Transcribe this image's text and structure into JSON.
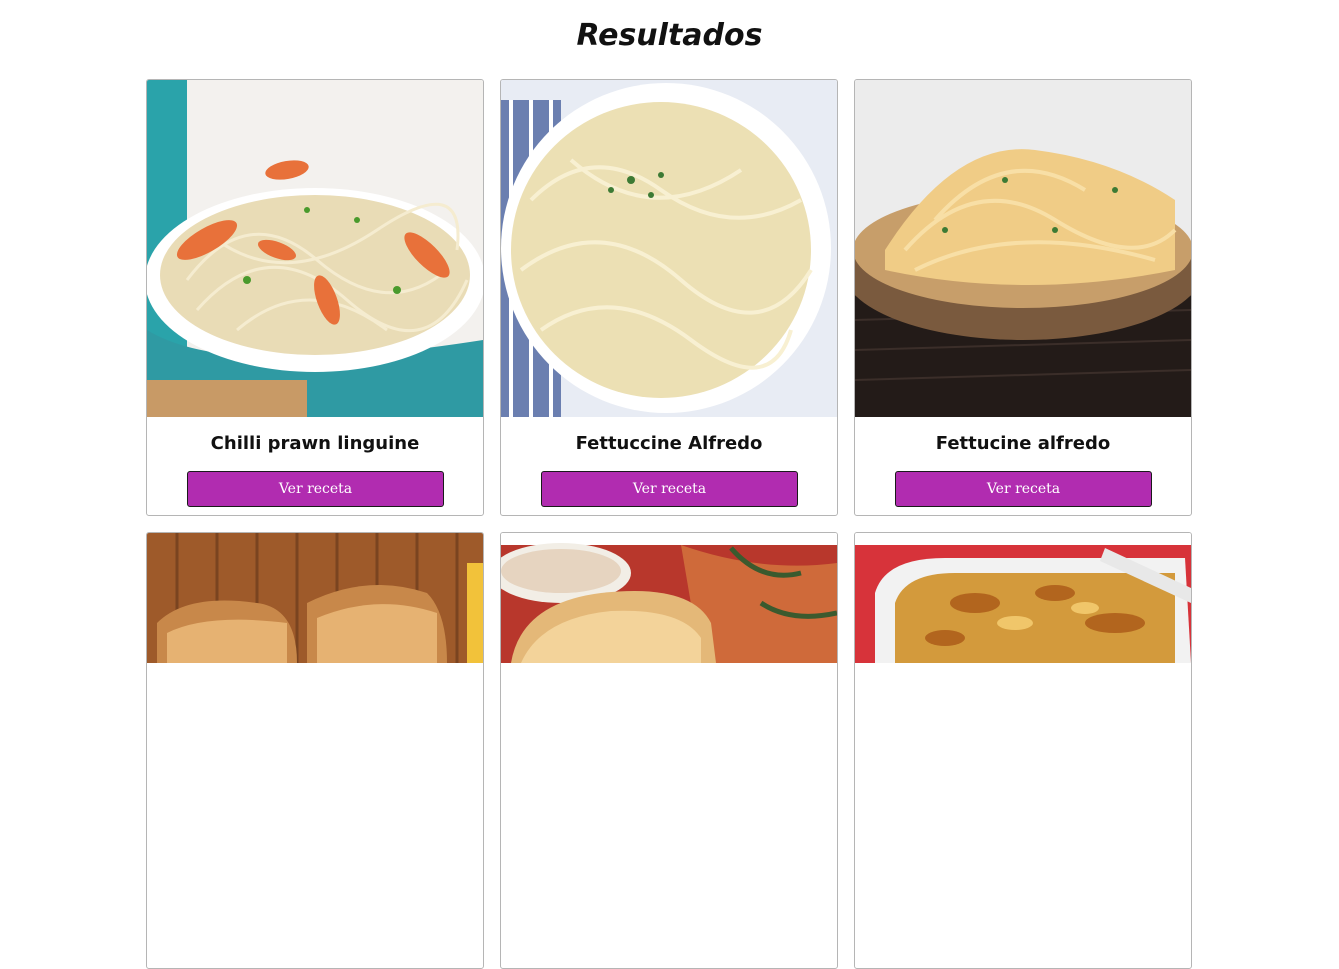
{
  "page": {
    "title": "Resultados"
  },
  "colors": {
    "button_bg": "#b12cb0",
    "card_border": "#b5b5b5"
  },
  "results": [
    {
      "title": "Chilli prawn linguine",
      "button_label": "Ver receta",
      "image": "pasta-with-prawns-photo"
    },
    {
      "title": "Fettuccine Alfredo",
      "button_label": "Ver receta",
      "image": "fettuccine-alfredo-white-plate-photo"
    },
    {
      "title": "Fettucine alfredo",
      "button_label": "Ver receta",
      "image": "fettucine-alfredo-bowl-photo"
    },
    {
      "title": "",
      "button_label": "",
      "image": "grilled-sandwich-wood-board-photo"
    },
    {
      "title": "",
      "button_label": "",
      "image": "grilled-sandwich-plate-photo"
    },
    {
      "title": "",
      "button_label": "",
      "image": "lasagna-dish-photo"
    }
  ]
}
